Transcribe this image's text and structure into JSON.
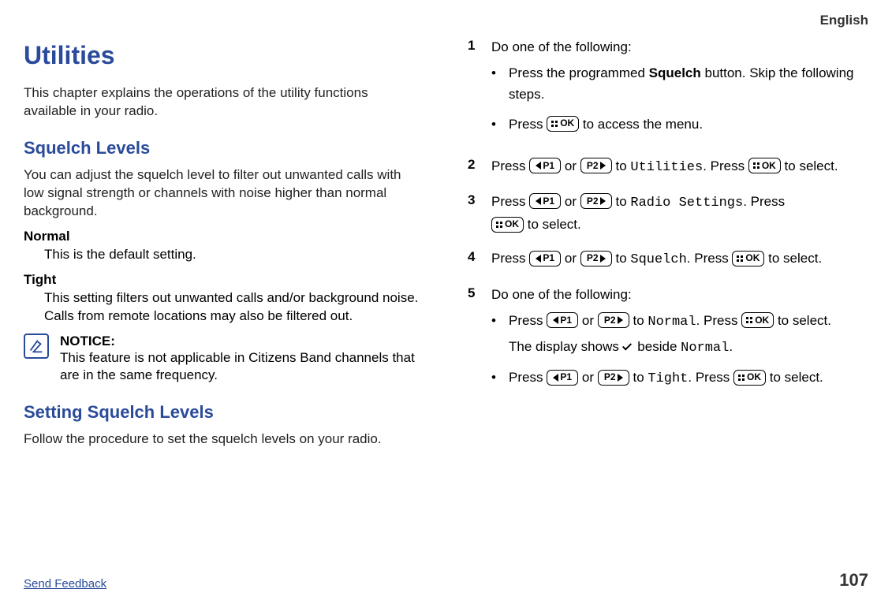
{
  "lang": "English",
  "h1": "Utilities",
  "intro": "This chapter explains the operations of the utility functions available in your radio.",
  "h2a": "Squelch Levels",
  "squelch_desc": "You can adjust the squelch level to filter out unwanted calls with low signal strength or channels with noise higher than normal background.",
  "normal_term": "Normal",
  "normal_def": "This is the default setting.",
  "tight_term": "Tight",
  "tight_def": "This setting filters out unwanted calls and/or background noise. Calls from remote locations may also be filtered out.",
  "notice_label": "NOTICE:",
  "notice_body": "This feature is not applicable in Citizens Band channels that are in the same frequency.",
  "h2b": "Setting Squelch Levels",
  "setting_desc": "Follow the procedure to set the squelch levels on your radio.",
  "keys": {
    "p1": "P1",
    "p2": "P2",
    "ok": "OK"
  },
  "step1": {
    "lead": "Do one of the following:",
    "b1a": "Press the programmed ",
    "b1_bold": "Squelch",
    "b1b": " button. Skip the following steps.",
    "b2a": "Press ",
    "b2b": " to access the menu."
  },
  "step2": {
    "a": "Press ",
    "or": " or ",
    "to": " to ",
    "menu": "Utilities",
    "press": ". Press ",
    "sel": " to select."
  },
  "step3": {
    "a": "Press ",
    "or": " or ",
    "to": " to ",
    "menu": "Radio Settings",
    "press": ". Press ",
    "sel": " to select."
  },
  "step4": {
    "a": "Press ",
    "or": " or ",
    "to": " to ",
    "menu": "Squelch",
    "press": ". Press ",
    "sel": " to select."
  },
  "step5": {
    "lead": "Do one of the following:",
    "b1": {
      "a": "Press ",
      "or": " or ",
      "to": " to ",
      "menu": "Normal",
      "press": ". Press ",
      "sel": " to select.",
      "sub1": "The display shows ",
      "sub2": " beside ",
      "sub_menu": "Normal",
      "sub3": "."
    },
    "b2": {
      "a": "Press ",
      "or": " or ",
      "to": " to ",
      "menu": "Tight",
      "press": ". Press ",
      "sel": " to select."
    }
  },
  "footer": {
    "feedback": "Send Feedback",
    "page": "107"
  }
}
